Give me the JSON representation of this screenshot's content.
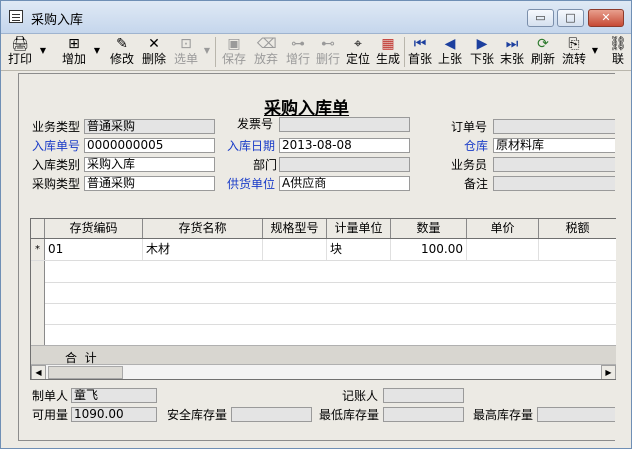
{
  "window": {
    "title": "采购入库",
    "controls": {
      "minimize": "▭",
      "maximize": "□",
      "close": "✕"
    }
  },
  "toolbar": [
    {
      "name": "print",
      "label": "打印",
      "icon": "printer-icon",
      "enabled": true
    },
    {
      "name": "add",
      "label": "增加",
      "icon": "add-icon",
      "enabled": true
    },
    {
      "name": "edit",
      "label": "修改",
      "icon": "edit-icon",
      "enabled": true
    },
    {
      "name": "delete",
      "label": "删除",
      "icon": "delete-icon",
      "enabled": true
    },
    {
      "name": "select",
      "label": "选单",
      "icon": "select-icon",
      "enabled": false
    },
    {
      "name": "save",
      "label": "保存",
      "icon": "save-icon",
      "enabled": false
    },
    {
      "name": "discard",
      "label": "放弃",
      "icon": "discard-icon",
      "enabled": false
    },
    {
      "name": "add-row",
      "label": "增行",
      "icon": "add-row-icon",
      "enabled": false
    },
    {
      "name": "delete-row",
      "label": "删行",
      "icon": "delete-row-icon",
      "enabled": false
    },
    {
      "name": "locate",
      "label": "定位",
      "icon": "locate-icon",
      "enabled": true
    },
    {
      "name": "generate",
      "label": "生成",
      "icon": "generate-icon",
      "enabled": true
    },
    {
      "name": "first",
      "label": "首张",
      "icon": "first-icon",
      "enabled": true
    },
    {
      "name": "prev",
      "label": "上张",
      "icon": "prev-icon",
      "enabled": true
    },
    {
      "name": "next",
      "label": "下张",
      "icon": "next-icon",
      "enabled": true
    },
    {
      "name": "last",
      "label": "末张",
      "icon": "last-icon",
      "enabled": true
    },
    {
      "name": "refresh",
      "label": "刷新",
      "icon": "refresh-icon",
      "enabled": true
    },
    {
      "name": "flow",
      "label": "流转",
      "icon": "flow-icon",
      "enabled": true
    },
    {
      "name": "link",
      "label": "联",
      "icon": "link-icon",
      "enabled": true
    }
  ],
  "form": {
    "title": "采购入库单",
    "business_type_label": "业务类型",
    "business_type_value": "普通采购",
    "invoice_no_label": "发票号",
    "invoice_no_value": "",
    "order_no_label": "订单号",
    "order_no_value": "",
    "receipt_no_label": "入库单号",
    "receipt_no_value": "0000000005",
    "receipt_date_label": "入库日期",
    "receipt_date_value": "2013-08-08",
    "warehouse_label": "仓库",
    "warehouse_value": "原材料库",
    "receipt_category_label": "入库类别",
    "receipt_category_value": "采购入库",
    "department_label": "部门",
    "department_value": "",
    "salesperson_label": "业务员",
    "salesperson_value": "",
    "purchase_type_label": "采购类型",
    "purchase_type_value": "普通采购",
    "supplier_label": "供货单位",
    "supplier_value": "A供应商",
    "remark_label": "备注",
    "remark_value": ""
  },
  "table": {
    "columns": [
      "存货编码",
      "存货名称",
      "规格型号",
      "计量单位",
      "数量",
      "单价",
      "税额"
    ],
    "rows": [
      {
        "marker": "*",
        "code": "01",
        "name": "木材",
        "spec": "",
        "unit": "块",
        "qty": "100.00",
        "price": "",
        "tax": ""
      }
    ],
    "total_label": "合  计"
  },
  "footer": {
    "maker_label": "制单人",
    "maker_value": "童飞",
    "bookkeeper_label": "记账人",
    "bookkeeper_value": "",
    "available_label": "可用量",
    "available_value": "1090.00",
    "safety_stock_label": "安全库存量",
    "safety_stock_value": "",
    "min_stock_label": "最低库存量",
    "min_stock_value": "",
    "max_stock_label": "最高库存量",
    "max_stock_value": ""
  },
  "colors": {
    "link_label": "#1a3cc8",
    "panel_bg": "#eceae4"
  }
}
